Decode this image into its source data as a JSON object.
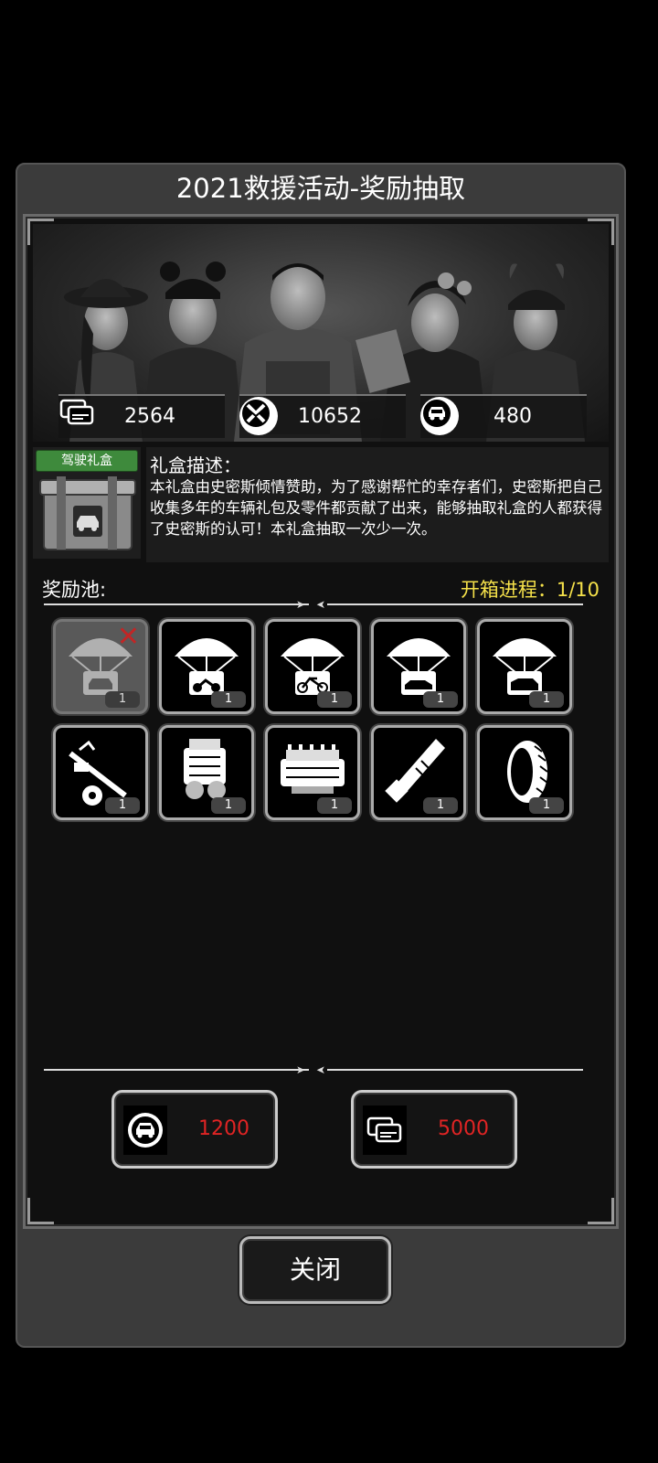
{
  "dialog": {
    "title": "2021救援活动-奖励抽取"
  },
  "resources": [
    {
      "icon": "ticket-card-icon",
      "value": "2564"
    },
    {
      "icon": "crossed-swords-badge-icon",
      "value": "10652"
    },
    {
      "icon": "car-badge-icon",
      "value": "480"
    }
  ],
  "gift_box": {
    "tag": "驾驶礼盒",
    "icon": "car-crate-icon",
    "desc_title": "礼盒描述：",
    "desc_body": "本礼盒由史密斯倾情赞助，为了感谢帮忙的幸存者们，史密斯把自己收集多年的车辆礼包及零件都贡献了出来，能够抽取礼盒的人都获得了史密斯的认可！本礼盒抽取一次少一次。"
  },
  "pool": {
    "label": "奖励池:",
    "progress": "开箱进程：1/10",
    "items": [
      {
        "icon": "parachute-car-icon",
        "count": "1",
        "claimed": true
      },
      {
        "icon": "parachute-motorbike-icon",
        "count": "1",
        "claimed": false
      },
      {
        "icon": "parachute-dirtbike-icon",
        "count": "1",
        "claimed": false
      },
      {
        "icon": "parachute-sedan-icon",
        "count": "1",
        "claimed": false
      },
      {
        "icon": "parachute-suv-icon",
        "count": "1",
        "claimed": false
      },
      {
        "icon": "axle-part-icon",
        "count": "1",
        "claimed": false
      },
      {
        "icon": "engine-part-icon",
        "count": "1",
        "claimed": false
      },
      {
        "icon": "engine-block-icon",
        "count": "1",
        "claimed": false
      },
      {
        "icon": "exhaust-part-icon",
        "count": "1",
        "claimed": false
      },
      {
        "icon": "tire-icon",
        "count": "1",
        "claimed": false
      }
    ]
  },
  "costs": [
    {
      "icon": "car-badge-icon",
      "value": "1200"
    },
    {
      "icon": "ticket-card-icon",
      "value": "5000"
    }
  ],
  "close_label": "关闭"
}
